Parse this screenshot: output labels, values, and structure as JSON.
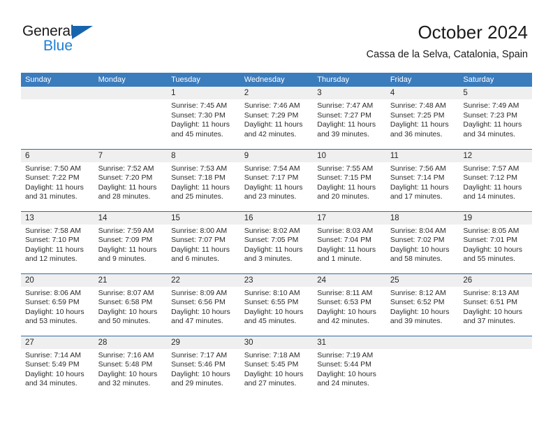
{
  "brand": {
    "name_top": "General",
    "name_bottom": "Blue",
    "triangle_color": "#1665ac",
    "blue_color": "#1f7fd4"
  },
  "header": {
    "title": "October 2024",
    "subtitle": "Cassa de la Selva, Catalonia, Spain"
  },
  "theme": {
    "header_blue": "#3b7cbd",
    "separator_blue": "#2b6ca8",
    "daynum_band": "#efefef",
    "text": "#2b2b2b"
  },
  "weekday_headers": [
    "Sunday",
    "Monday",
    "Tuesday",
    "Wednesday",
    "Thursday",
    "Friday",
    "Saturday"
  ],
  "weeks": [
    [
      {
        "day": "",
        "sunrise": "",
        "sunset": "",
        "daylight": ""
      },
      {
        "day": "",
        "sunrise": "",
        "sunset": "",
        "daylight": ""
      },
      {
        "day": "1",
        "sunrise": "Sunrise: 7:45 AM",
        "sunset": "Sunset: 7:30 PM",
        "daylight": "Daylight: 11 hours and 45 minutes."
      },
      {
        "day": "2",
        "sunrise": "Sunrise: 7:46 AM",
        "sunset": "Sunset: 7:29 PM",
        "daylight": "Daylight: 11 hours and 42 minutes."
      },
      {
        "day": "3",
        "sunrise": "Sunrise: 7:47 AM",
        "sunset": "Sunset: 7:27 PM",
        "daylight": "Daylight: 11 hours and 39 minutes."
      },
      {
        "day": "4",
        "sunrise": "Sunrise: 7:48 AM",
        "sunset": "Sunset: 7:25 PM",
        "daylight": "Daylight: 11 hours and 36 minutes."
      },
      {
        "day": "5",
        "sunrise": "Sunrise: 7:49 AM",
        "sunset": "Sunset: 7:23 PM",
        "daylight": "Daylight: 11 hours and 34 minutes."
      }
    ],
    [
      {
        "day": "6",
        "sunrise": "Sunrise: 7:50 AM",
        "sunset": "Sunset: 7:22 PM",
        "daylight": "Daylight: 11 hours and 31 minutes."
      },
      {
        "day": "7",
        "sunrise": "Sunrise: 7:52 AM",
        "sunset": "Sunset: 7:20 PM",
        "daylight": "Daylight: 11 hours and 28 minutes."
      },
      {
        "day": "8",
        "sunrise": "Sunrise: 7:53 AM",
        "sunset": "Sunset: 7:18 PM",
        "daylight": "Daylight: 11 hours and 25 minutes."
      },
      {
        "day": "9",
        "sunrise": "Sunrise: 7:54 AM",
        "sunset": "Sunset: 7:17 PM",
        "daylight": "Daylight: 11 hours and 23 minutes."
      },
      {
        "day": "10",
        "sunrise": "Sunrise: 7:55 AM",
        "sunset": "Sunset: 7:15 PM",
        "daylight": "Daylight: 11 hours and 20 minutes."
      },
      {
        "day": "11",
        "sunrise": "Sunrise: 7:56 AM",
        "sunset": "Sunset: 7:14 PM",
        "daylight": "Daylight: 11 hours and 17 minutes."
      },
      {
        "day": "12",
        "sunrise": "Sunrise: 7:57 AM",
        "sunset": "Sunset: 7:12 PM",
        "daylight": "Daylight: 11 hours and 14 minutes."
      }
    ],
    [
      {
        "day": "13",
        "sunrise": "Sunrise: 7:58 AM",
        "sunset": "Sunset: 7:10 PM",
        "daylight": "Daylight: 11 hours and 12 minutes."
      },
      {
        "day": "14",
        "sunrise": "Sunrise: 7:59 AM",
        "sunset": "Sunset: 7:09 PM",
        "daylight": "Daylight: 11 hours and 9 minutes."
      },
      {
        "day": "15",
        "sunrise": "Sunrise: 8:00 AM",
        "sunset": "Sunset: 7:07 PM",
        "daylight": "Daylight: 11 hours and 6 minutes."
      },
      {
        "day": "16",
        "sunrise": "Sunrise: 8:02 AM",
        "sunset": "Sunset: 7:05 PM",
        "daylight": "Daylight: 11 hours and 3 minutes."
      },
      {
        "day": "17",
        "sunrise": "Sunrise: 8:03 AM",
        "sunset": "Sunset: 7:04 PM",
        "daylight": "Daylight: 11 hours and 1 minute."
      },
      {
        "day": "18",
        "sunrise": "Sunrise: 8:04 AM",
        "sunset": "Sunset: 7:02 PM",
        "daylight": "Daylight: 10 hours and 58 minutes."
      },
      {
        "day": "19",
        "sunrise": "Sunrise: 8:05 AM",
        "sunset": "Sunset: 7:01 PM",
        "daylight": "Daylight: 10 hours and 55 minutes."
      }
    ],
    [
      {
        "day": "20",
        "sunrise": "Sunrise: 8:06 AM",
        "sunset": "Sunset: 6:59 PM",
        "daylight": "Daylight: 10 hours and 53 minutes."
      },
      {
        "day": "21",
        "sunrise": "Sunrise: 8:07 AM",
        "sunset": "Sunset: 6:58 PM",
        "daylight": "Daylight: 10 hours and 50 minutes."
      },
      {
        "day": "22",
        "sunrise": "Sunrise: 8:09 AM",
        "sunset": "Sunset: 6:56 PM",
        "daylight": "Daylight: 10 hours and 47 minutes."
      },
      {
        "day": "23",
        "sunrise": "Sunrise: 8:10 AM",
        "sunset": "Sunset: 6:55 PM",
        "daylight": "Daylight: 10 hours and 45 minutes."
      },
      {
        "day": "24",
        "sunrise": "Sunrise: 8:11 AM",
        "sunset": "Sunset: 6:53 PM",
        "daylight": "Daylight: 10 hours and 42 minutes."
      },
      {
        "day": "25",
        "sunrise": "Sunrise: 8:12 AM",
        "sunset": "Sunset: 6:52 PM",
        "daylight": "Daylight: 10 hours and 39 minutes."
      },
      {
        "day": "26",
        "sunrise": "Sunrise: 8:13 AM",
        "sunset": "Sunset: 6:51 PM",
        "daylight": "Daylight: 10 hours and 37 minutes."
      }
    ],
    [
      {
        "day": "27",
        "sunrise": "Sunrise: 7:14 AM",
        "sunset": "Sunset: 5:49 PM",
        "daylight": "Daylight: 10 hours and 34 minutes."
      },
      {
        "day": "28",
        "sunrise": "Sunrise: 7:16 AM",
        "sunset": "Sunset: 5:48 PM",
        "daylight": "Daylight: 10 hours and 32 minutes."
      },
      {
        "day": "29",
        "sunrise": "Sunrise: 7:17 AM",
        "sunset": "Sunset: 5:46 PM",
        "daylight": "Daylight: 10 hours and 29 minutes."
      },
      {
        "day": "30",
        "sunrise": "Sunrise: 7:18 AM",
        "sunset": "Sunset: 5:45 PM",
        "daylight": "Daylight: 10 hours and 27 minutes."
      },
      {
        "day": "31",
        "sunrise": "Sunrise: 7:19 AM",
        "sunset": "Sunset: 5:44 PM",
        "daylight": "Daylight: 10 hours and 24 minutes."
      },
      {
        "day": "",
        "sunrise": "",
        "sunset": "",
        "daylight": ""
      },
      {
        "day": "",
        "sunrise": "",
        "sunset": "",
        "daylight": ""
      }
    ]
  ]
}
